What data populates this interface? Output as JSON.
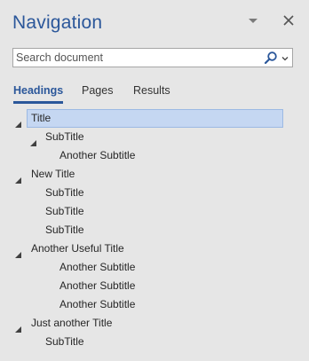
{
  "pane": {
    "title": "Navigation",
    "menu_icon": "triangle-down-icon",
    "close_icon": "close-icon"
  },
  "search": {
    "placeholder": "Search document",
    "value": "",
    "search_icon": "magnifier-icon",
    "dropdown_icon": "chevron-down-icon"
  },
  "tabs": [
    {
      "label": "Headings",
      "active": true
    },
    {
      "label": "Pages",
      "active": false
    },
    {
      "label": "Results",
      "active": false
    }
  ],
  "headings": [
    {
      "label": "Title",
      "level": 1,
      "expanded": true,
      "selected": true
    },
    {
      "label": "SubTitle",
      "level": 2,
      "expanded": true,
      "selected": false
    },
    {
      "label": "Another Subtitle",
      "level": 3,
      "selected": false
    },
    {
      "label": "New Title",
      "level": 1,
      "expanded": true,
      "selected": false
    },
    {
      "label": "SubTitle",
      "level": 2,
      "selected": false
    },
    {
      "label": "SubTitle",
      "level": 2,
      "selected": false
    },
    {
      "label": "SubTitle",
      "level": 2,
      "selected": false
    },
    {
      "label": "Another Useful Title",
      "level": 1,
      "expanded": true,
      "selected": false
    },
    {
      "label": "Another Subtitle",
      "level": 3,
      "selected": false
    },
    {
      "label": "Another Subtitle",
      "level": 3,
      "selected": false
    },
    {
      "label": "Another Subtitle",
      "level": 3,
      "selected": false
    },
    {
      "label": "Just another Title",
      "level": 1,
      "expanded": true,
      "selected": false
    },
    {
      "label": "SubTitle",
      "level": 2,
      "selected": false
    }
  ],
  "colors": {
    "accent": "#2b579a",
    "selection": "#c5d7f2",
    "background": "#e6e6e6"
  }
}
